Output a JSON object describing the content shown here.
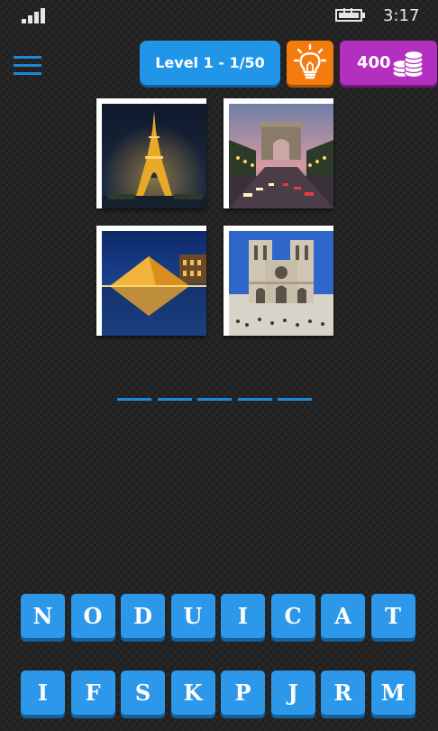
{
  "status": {
    "time": "3:17",
    "signal_icon": "signal-bars-icon",
    "battery_icon": "battery-charging-icon"
  },
  "header": {
    "menu_icon": "hamburger-menu-icon",
    "level_label": "Level 1 - 1/50",
    "hint_icon": "lightbulb-icon",
    "coins": "400",
    "coins_icon": "coin-stack-icon"
  },
  "pictures": [
    {
      "subject": "eiffel-tower"
    },
    {
      "subject": "arc-de-triomphe"
    },
    {
      "subject": "louvre-pyramid"
    },
    {
      "subject": "notre-dame"
    }
  ],
  "answer": {
    "slot_count": 5,
    "filled": [
      "",
      "",
      "",
      "",
      ""
    ]
  },
  "letters": {
    "row1": [
      "N",
      "O",
      "D",
      "U",
      "I",
      "C",
      "A",
      "T"
    ],
    "row2": [
      "I",
      "F",
      "S",
      "K",
      "P",
      "J",
      "R",
      "M"
    ]
  },
  "colors": {
    "accent_blue": "#2196e8",
    "hint_orange": "#f47c0e",
    "coins_purple": "#b22fbf",
    "background": "#242424"
  }
}
